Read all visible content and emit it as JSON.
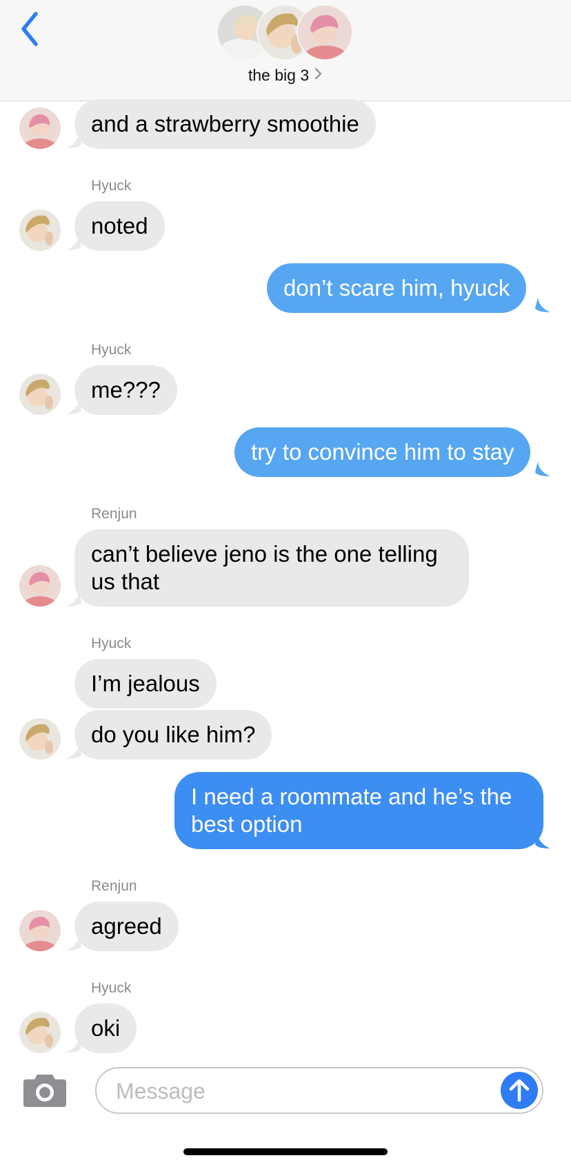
{
  "header": {
    "title": "the big 3",
    "back_icon": "chevron-left-icon",
    "title_chevron_icon": "chevron-right-icon",
    "accent_color": "#2f7cf6"
  },
  "messages": [
    {
      "direction": "in",
      "avatar": "renjun",
      "text": "and a strawberry smoothie"
    },
    {
      "direction": "in",
      "sender": "Hyuck",
      "avatar": "hyuck",
      "text": "noted"
    },
    {
      "direction": "out",
      "text": "don’t scare him, hyuck"
    },
    {
      "direction": "in",
      "sender": "Hyuck",
      "avatar": "hyuck",
      "text": "me???"
    },
    {
      "direction": "out",
      "text": "try to convince him to stay"
    },
    {
      "direction": "in",
      "sender": "Renjun",
      "avatar": "renjun",
      "text": "can’t believe jeno is the one telling us that"
    },
    {
      "direction": "in",
      "sender": "Hyuck",
      "text": "I’m jealous"
    },
    {
      "direction": "in",
      "avatar": "hyuck",
      "text": "do you like him?"
    },
    {
      "direction": "out",
      "text": "I need a roommate and he’s the best option"
    },
    {
      "direction": "in",
      "sender": "Renjun",
      "avatar": "renjun",
      "text": "agreed"
    },
    {
      "direction": "in",
      "sender": "Hyuck",
      "avatar": "hyuck",
      "text": "oki"
    }
  ],
  "composer": {
    "placeholder": "Message",
    "value": "",
    "camera_icon": "camera-icon",
    "send_icon": "arrow-up-icon"
  },
  "colors": {
    "incoming_bubble": "#e9e9eb",
    "outgoing_bubble": "#56a6f2",
    "outgoing_bubble_latest": "#3d8ef2",
    "sender_label": "#8a8a8e"
  }
}
